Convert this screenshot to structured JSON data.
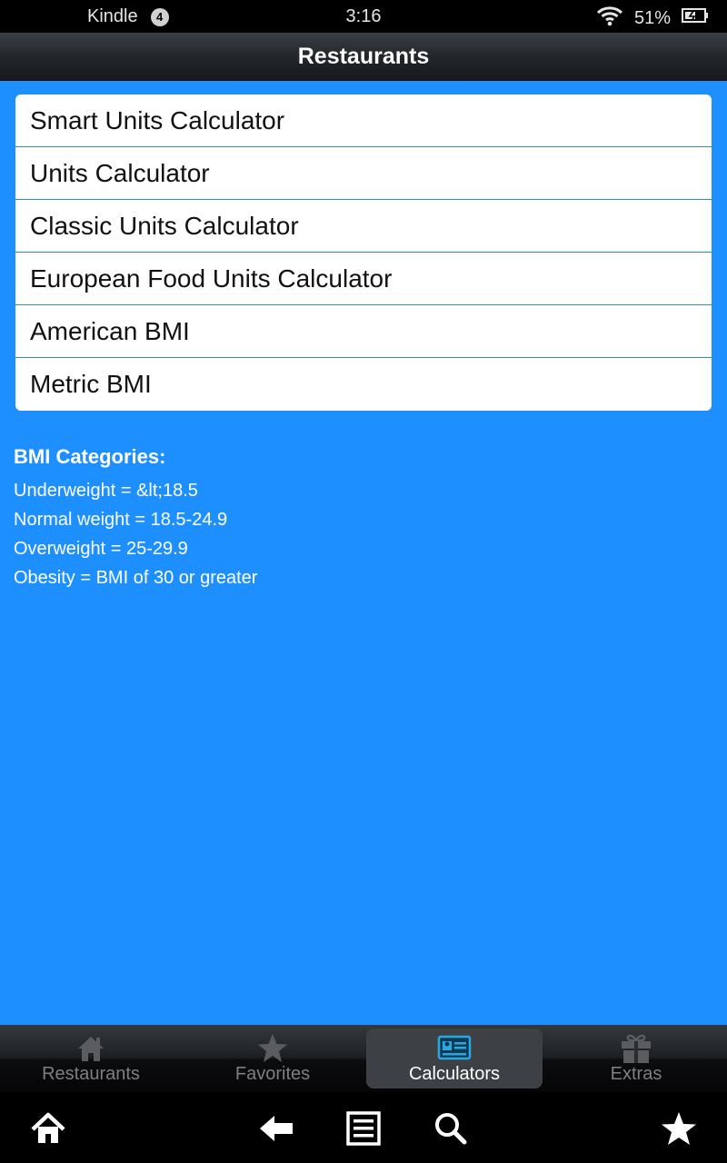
{
  "status": {
    "carrier": "Kindle",
    "notification_count": "4",
    "time": "3:16",
    "battery": "51%"
  },
  "header": {
    "title": "Restaurants"
  },
  "menu": {
    "items": [
      "Smart Units Calculator",
      "Units Calculator",
      "Classic Units Calculator",
      "European Food Units Calculator",
      "American BMI",
      "Metric BMI"
    ]
  },
  "bmi": {
    "heading": "BMI Categories:",
    "lines": [
      "Underweight = &lt;18.5",
      "Normal weight = 18.5-24.9",
      "Overweight = 25-29.9",
      "Obesity = BMI of 30 or greater"
    ]
  },
  "tabs": [
    {
      "label": "Restaurants",
      "icon": "house-icon"
    },
    {
      "label": "Favorites",
      "icon": "star-icon"
    },
    {
      "label": "Calculators",
      "icon": "calculator-icon",
      "active": true
    },
    {
      "label": "Extras",
      "icon": "gift-icon"
    }
  ],
  "nav": [
    "home-icon",
    "back-arrow-icon",
    "menu-list-icon",
    "search-icon",
    "favorite-star-icon"
  ],
  "colors": {
    "background": "#1e8ffe",
    "accent": "#29a9e0"
  }
}
